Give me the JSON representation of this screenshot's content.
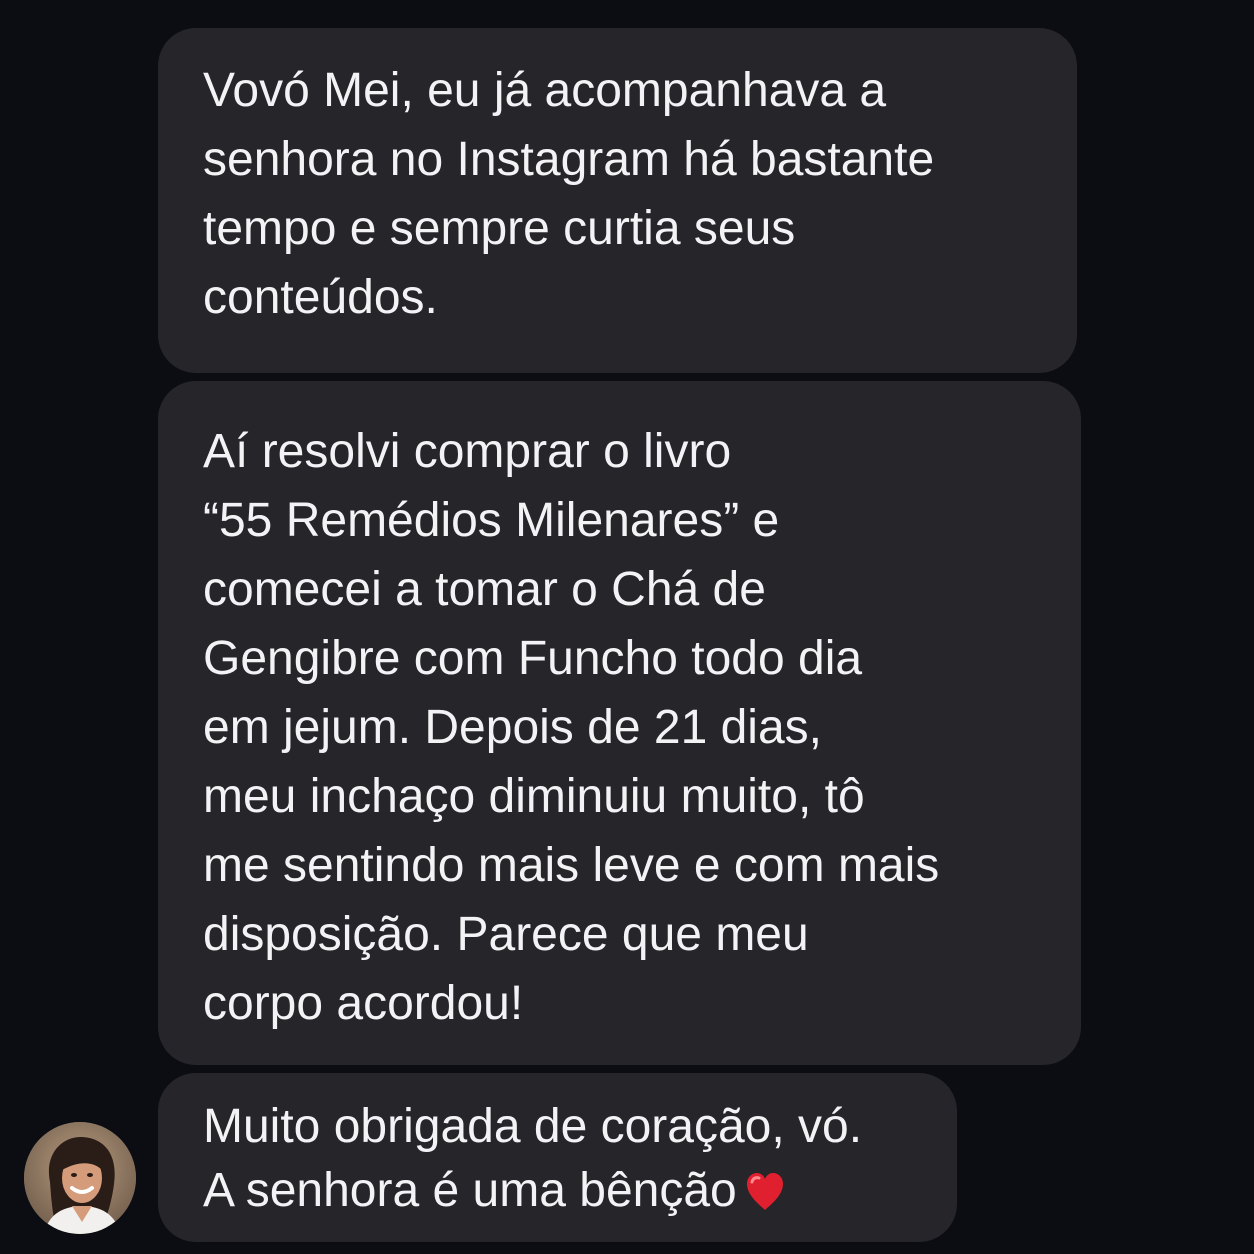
{
  "messages": [
    {
      "lines": [
        "Vovó Mei, eu já acompanhava a",
        "senhora no Instagram há bastante",
        "tempo e sempre curtia seus",
        "conteúdos."
      ]
    },
    {
      "lines": [
        "Aí resolvi comprar o livro",
        "“55 Remédios Milenares” e",
        "comecei a tomar o Chá de",
        "Gengibre com Funcho todo dia",
        "em jejum. Depois de 21 dias,",
        "meu inchaço diminuiu muito, tô",
        "me sentindo mais leve e com mais",
        "disposição. Parece que meu",
        "corpo acordou!"
      ]
    },
    {
      "lines": [
        "Muito obrigada de coração, vó.",
        "A senhora é uma bênção"
      ],
      "emoji": "red-heart-icon"
    }
  ],
  "colors": {
    "background": "#0b0d13",
    "bubble": "#25252a",
    "text": "#f3f3f5",
    "heart": "#e0202f"
  }
}
